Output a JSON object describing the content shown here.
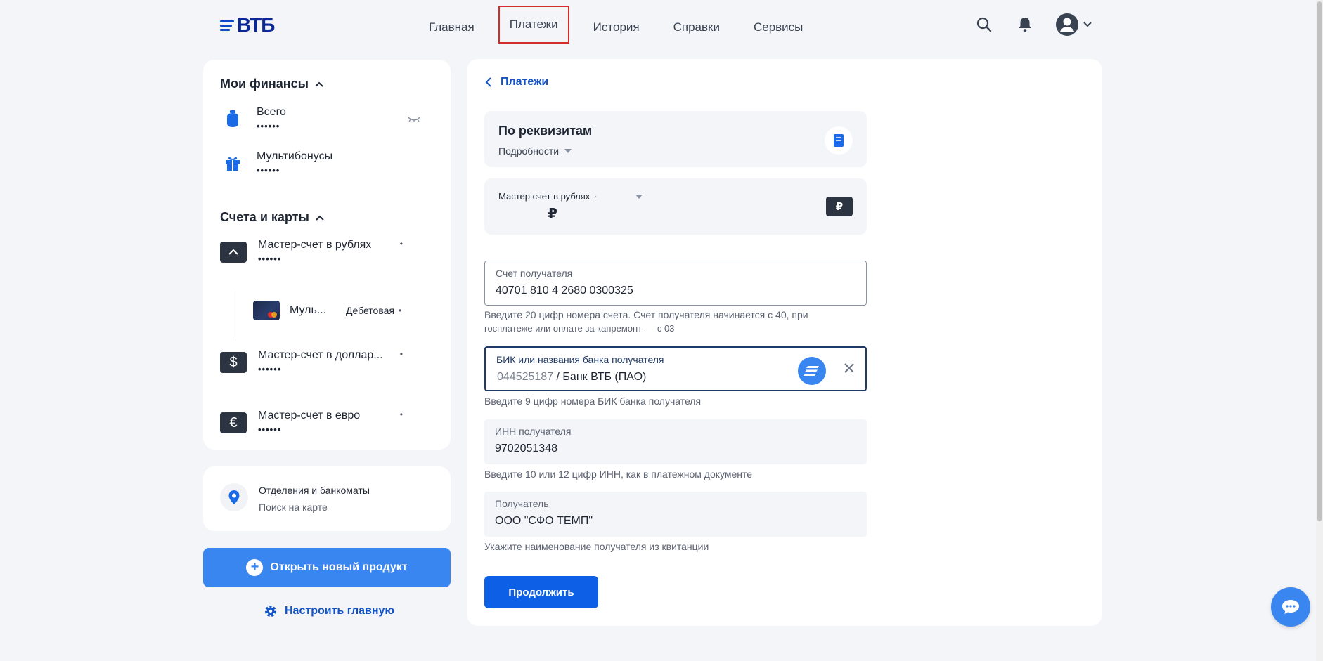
{
  "header": {
    "logo_text": "ВТБ",
    "nav": [
      "Главная",
      "Платежи",
      "История",
      "Справки",
      "Сервисы"
    ],
    "active_nav_index": 1,
    "icons": [
      "search-icon",
      "bell-icon",
      "user-avatar-icon",
      "chevron-down-icon"
    ]
  },
  "sidebar": {
    "finances_title": "Мои финансы",
    "finances": [
      {
        "label": "Всего",
        "value": "••••••",
        "icon": "money-bag-icon"
      },
      {
        "label": "Мультибонусы",
        "value": "••••••",
        "icon": "gift-icon"
      }
    ],
    "accounts_title": "Счета и карты",
    "accounts": [
      {
        "name": "Мастер-счет в рублях",
        "value": "••••••",
        "bullet": "•",
        "icon_glyph": "^"
      },
      {
        "name": "Мастер-счет в доллар...",
        "value": "••••••",
        "bullet": "•",
        "icon_glyph": "$"
      },
      {
        "name": "Мастер-счет в евро",
        "value": "••••••",
        "bullet": "•",
        "icon_glyph": "€"
      }
    ],
    "sub_card": {
      "name": "Муль...",
      "type": "Дебетовая",
      "bullet": "•"
    },
    "branches": {
      "title": "Отделения и банкоматы",
      "subtitle": "Поиск на карте"
    },
    "open_product": "Открыть новый продукт",
    "configure_home": "Настроить главную"
  },
  "main": {
    "back_label": "Платежи",
    "payment_type": {
      "title": "По реквизитам",
      "details_label": "Подробности"
    },
    "source_account": {
      "label": "Мастер  счет в рублях",
      "dot": "·",
      "amount": "₽",
      "currency_badge": "₽"
    },
    "fields": {
      "account": {
        "label": "Счет получателя",
        "value": "40701 810 4 2680 0300325",
        "hint_line1": "Введите 20 цифр номера счета. Счет получателя начинается с 40, при",
        "hint_line2": "госплатеже или оплате за капремонт      с 03"
      },
      "bik": {
        "label": "БИК или названия банка получателя",
        "bik_value": "044525187",
        "bank_name": " / Банк ВТБ (ПАО)",
        "hint": "Введите 9 цифр номера БИК банка получателя"
      },
      "inn": {
        "label": "ИНН получателя",
        "value": "9702051348",
        "hint": "Введите 10 или 12 цифр ИНН, как в платежном документе"
      },
      "recipient": {
        "label": "Получатель",
        "value": "ООО \"СФО ТЕМП\"",
        "hint": "Укажите наименование получателя из квитанции"
      }
    },
    "continue_label": "Продолжить"
  },
  "colors": {
    "brand_blue": "#0a2896",
    "accent": "#3a86f0",
    "primary_button": "#0d60e5",
    "active_nav_border": "#d42b2b"
  }
}
